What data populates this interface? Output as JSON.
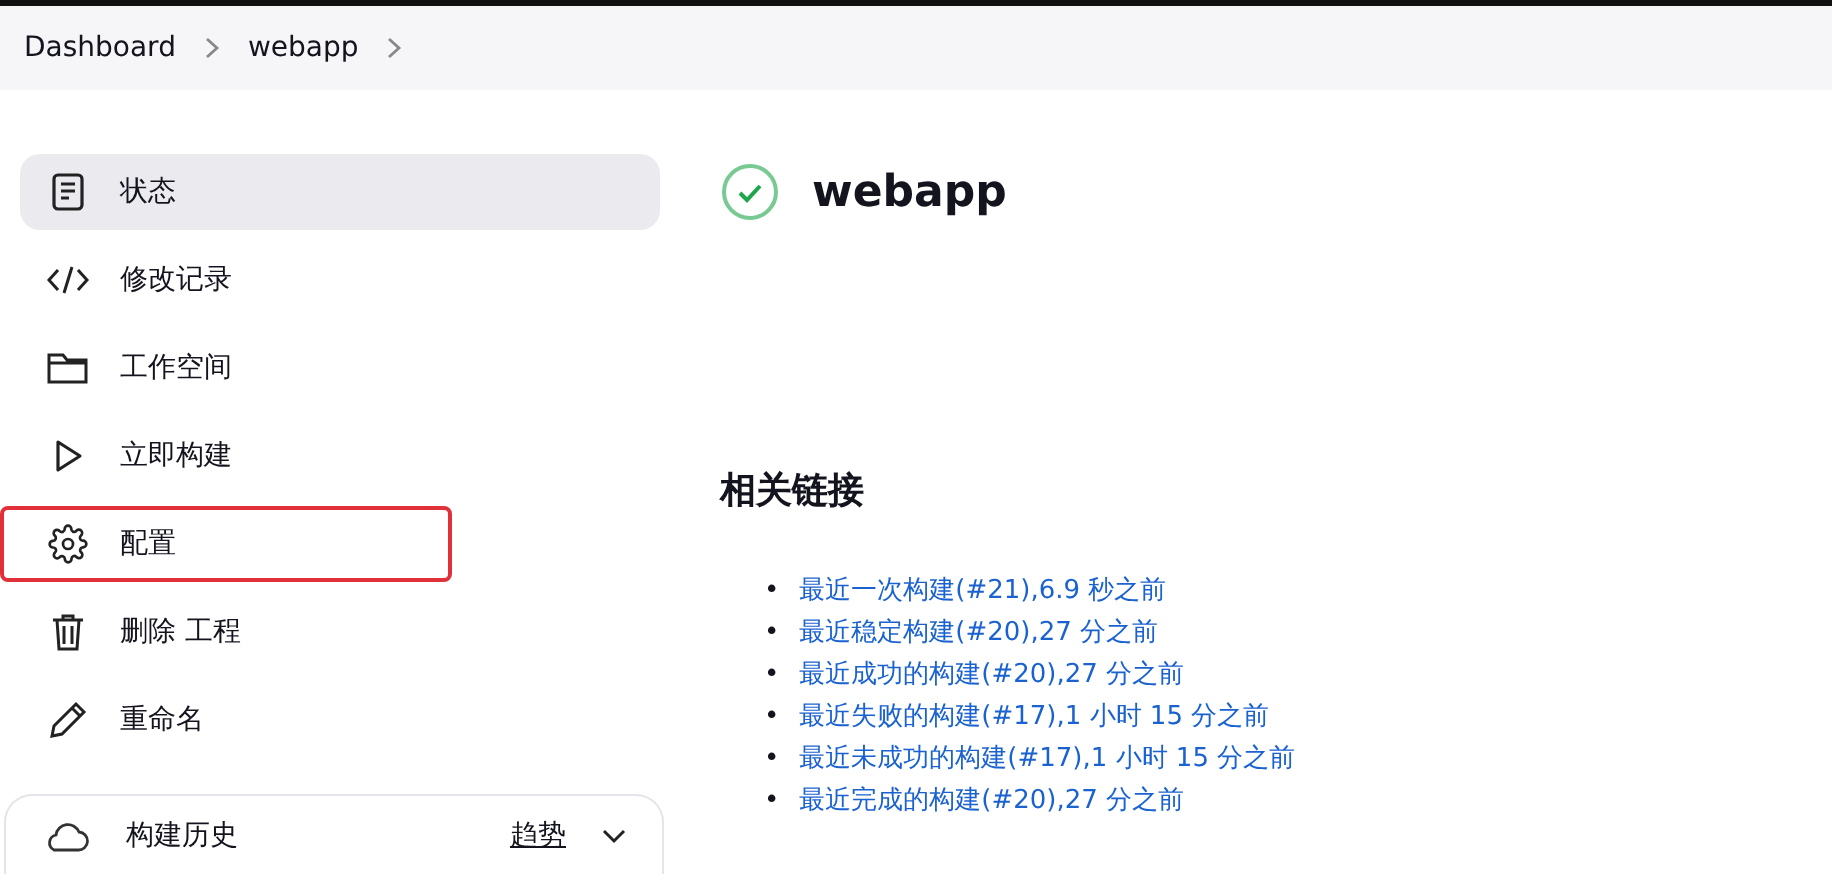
{
  "breadcrumbs": [
    {
      "label": "Dashboard"
    },
    {
      "label": "webapp"
    }
  ],
  "sidebar": {
    "items": [
      {
        "label": "状态",
        "kind": "status",
        "selected": true,
        "highlighted": false
      },
      {
        "label": "修改记录",
        "kind": "changes",
        "selected": false,
        "highlighted": false
      },
      {
        "label": "工作空间",
        "kind": "workspace",
        "selected": false,
        "highlighted": false
      },
      {
        "label": "立即构建",
        "kind": "build",
        "selected": false,
        "highlighted": false
      },
      {
        "label": "配置",
        "kind": "configure",
        "selected": false,
        "highlighted": true
      },
      {
        "label": "删除 工程",
        "kind": "delete",
        "selected": false,
        "highlighted": false
      },
      {
        "label": "重命名",
        "kind": "rename",
        "selected": false,
        "highlighted": false
      }
    ],
    "build_history": {
      "title": "构建历史",
      "trend": "趋势"
    }
  },
  "main": {
    "title": "webapp",
    "success": true,
    "section_title": "相关链接",
    "links": [
      {
        "bullet": "•",
        "text": "最近一次构建(#21),6.9 秒之前"
      },
      {
        "bullet": "•",
        "text": "最近稳定构建(#20),27 分之前"
      },
      {
        "bullet": "•",
        "text": "最近成功的构建(#20),27 分之前"
      },
      {
        "bullet": "•",
        "text": "最近失败的构建(#17),1 小时 15 分之前"
      },
      {
        "bullet": "•",
        "text": "最近未成功的构建(#17),1 小时 15 分之前"
      },
      {
        "bullet": "•",
        "text": "最近完成的构建(#20),27 分之前"
      }
    ]
  }
}
